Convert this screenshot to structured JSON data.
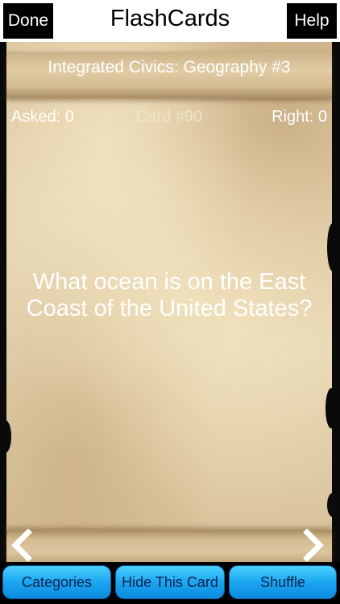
{
  "navbar": {
    "done_label": "Done",
    "title": "FlashCards",
    "help_label": "Help"
  },
  "card": {
    "deck_title": "Integrated Civics: Geography #3",
    "asked_label": "Asked: 0",
    "card_number_label": "Card #90",
    "right_label": "Right: 0",
    "question": "What ocean is on the East Coast of the United States?"
  },
  "navigation": {
    "prev_icon": "chevron-left-icon",
    "next_icon": "chevron-right-icon"
  },
  "toolbar": {
    "categories_label": "Categories",
    "hide_label": "Hide This Card",
    "shuffle_label": "Shuffle"
  },
  "colors": {
    "toolbar_button": "#1aa6f0",
    "toolbar_text": "#0d2350",
    "nav_button": "#000000",
    "parchment": "#e4d2ae"
  }
}
